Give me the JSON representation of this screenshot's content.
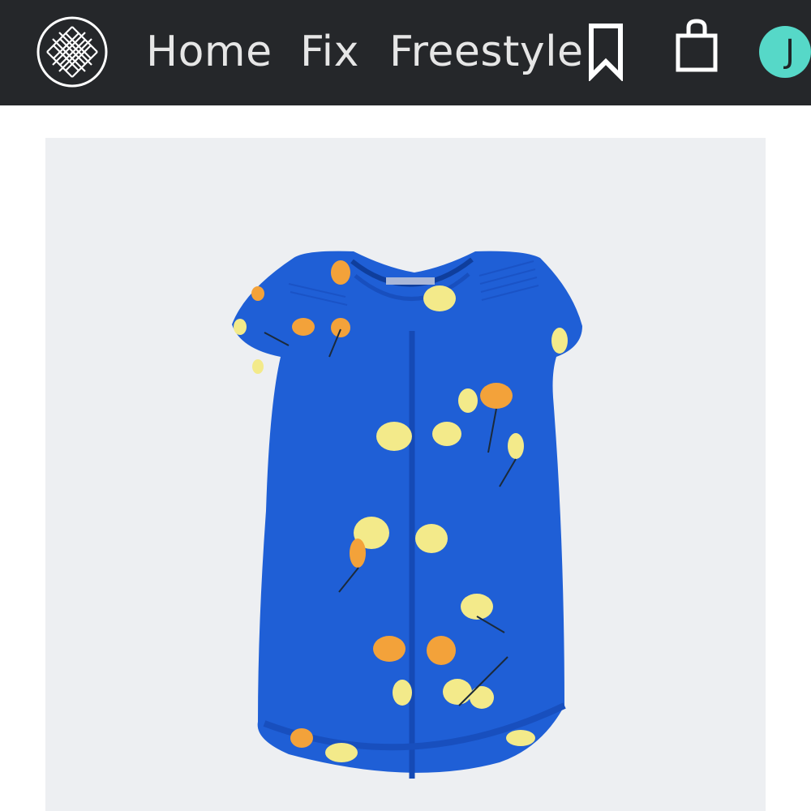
{
  "header": {
    "logo_icon": "stitch-fix-lattice-logo-icon",
    "nav": [
      {
        "label": "Home"
      },
      {
        "label": "Fix"
      },
      {
        "label": "Freestyle"
      }
    ],
    "bookmark_icon": "bookmark-icon",
    "bag_icon": "shopping-bag-icon",
    "avatar_initial": "J",
    "colors": {
      "bar": "#25272a",
      "nav_text": "#e6e6e6",
      "avatar": "#56d8c8"
    }
  },
  "product": {
    "image_description_icon": "blue-floral-blouse-image",
    "colors": {
      "panel_bg": "#edeff2",
      "blouse": "#1f5fd6",
      "flower_yellow": "#f3ea8a",
      "flower_orange": "#f3a23a"
    }
  }
}
